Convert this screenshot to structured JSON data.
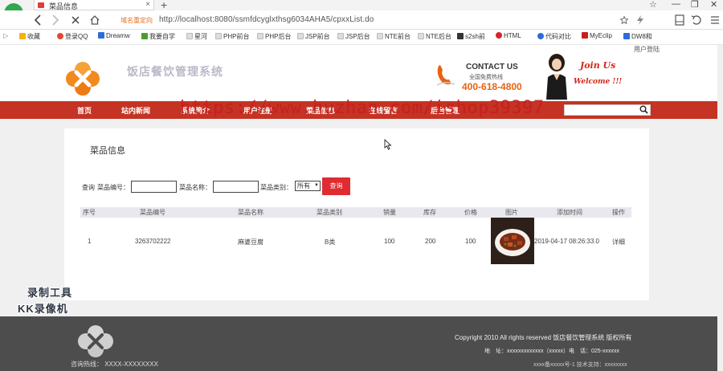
{
  "browser": {
    "tab_title": "菜品信息",
    "tab_close": "×",
    "new_tab": "+",
    "url_badge": "域名重定向",
    "url": "http://localhost:8080/ssmfdcyglxthsg6034AHA5/cpxxList.do",
    "window_controls": [
      "☆",
      "—",
      "❐",
      "✕"
    ],
    "bookmarks": [
      {
        "label": "收藏",
        "color": "#f2b600"
      },
      {
        "label": "登录QQ",
        "color": "#e04a2f"
      },
      {
        "label": "Dreamw",
        "color": "#2f6cd8"
      },
      {
        "label": "我要自学",
        "color": "#4a9d2f"
      },
      {
        "label": "星河",
        "color": "#cccccc"
      },
      {
        "label": "PHP前台",
        "color": "#cccccc"
      },
      {
        "label": "PHP后台",
        "color": "#cccccc"
      },
      {
        "label": "JSP前台",
        "color": "#cccccc"
      },
      {
        "label": "JSP后台",
        "color": "#cccccc"
      },
      {
        "label": "NTE前台",
        "color": "#cccccc"
      },
      {
        "label": "NTE后台",
        "color": "#cccccc"
      },
      {
        "label": "s2sh前",
        "color": "#333333"
      },
      {
        "label": "HTML",
        "color": "#d8262a"
      },
      {
        "label": "代码对比",
        "color": "#2f6cd8"
      },
      {
        "label": "MyEclip",
        "color": "#c81d1d"
      },
      {
        "label": "DW8和",
        "color": "#2f6cd8"
      }
    ]
  },
  "header": {
    "site_name": "饭店餐饮管理系统",
    "contact_title": "CONTACT US",
    "contact_sub": "全国免费热线",
    "contact_number": "400-618-4800",
    "join_us": "Join Us",
    "welcome": "Welcome !!!",
    "login_link": "用户登陆"
  },
  "nav": {
    "items": [
      "首页",
      "站内新闻",
      "系统简介",
      "用户注册",
      "菜品信息",
      "在线留言",
      "后台管理"
    ],
    "watermark": "https://www.huzhan.com/ishop39397"
  },
  "main": {
    "panel_title": "菜品信息",
    "search": {
      "prefix": "查询",
      "code_label": "菜品编号：",
      "name_label": "菜品名称：",
      "category_label": "菜品类别：",
      "category_value": "所有",
      "query_button": "查询"
    },
    "table": {
      "headers": [
        "序号",
        "菜品编号",
        "菜品名称",
        "菜品类别",
        "销量",
        "库存",
        "价格",
        "图片",
        "添加时间",
        "操作"
      ],
      "rows": [
        {
          "index": "1",
          "code": "3263702222",
          "name": "麻婆豆腐",
          "category": "B类",
          "sales": "100",
          "stock": "200",
          "price": "100",
          "added": "2019-04-17 08:26:33.0",
          "action": "详细"
        }
      ]
    }
  },
  "recorder": {
    "line1": "录制工具",
    "line2": "KK录像机"
  },
  "footer": {
    "hotline": "咨询热线： XXXX-XXXXXXXX",
    "copyright": "Copyright 2010 All rights reserved 饭店餐饮管理系统 版权所有",
    "address": "地　址：xxxxxxxxxxxxx（xxxxx）电　话：025-xxxxxx",
    "icp": "xxxx备xxxxx号-1 技术支持：xxxxxxxx"
  }
}
